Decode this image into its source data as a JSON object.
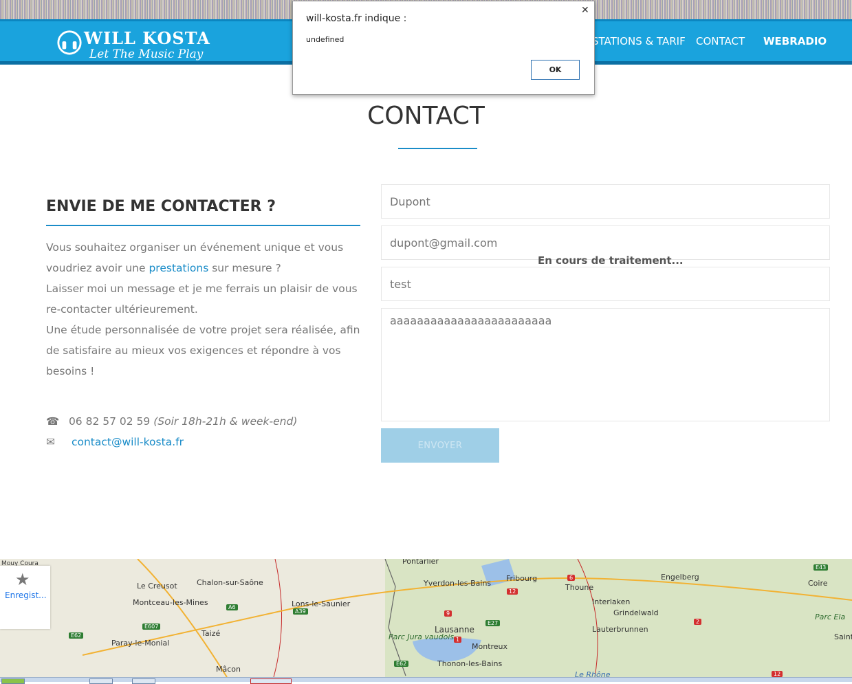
{
  "colors": {
    "brand": "#1aa3dd",
    "accent": "#1a8cc8",
    "button_disabled": "#9fcfe7"
  },
  "header": {
    "logo_title": "WILL KOSTA",
    "logo_subtitle": "Let The Music Play",
    "nav": [
      "STATIONS & TARIF",
      "CONTACT",
      "WEBRADIO"
    ]
  },
  "dialog": {
    "title": "will-kosta.fr indique :",
    "message": "undefined",
    "ok_label": "OK",
    "close_icon": "close-icon"
  },
  "main": {
    "title": "CONTACT",
    "left": {
      "heading": "ENVIE DE ME CONTACTER ?",
      "p1_a": "Vous souhaitez organiser un événement unique et vous voudriez avoir une ",
      "p1_link": "prestations",
      "p1_b": " sur mesure ?",
      "p2": "Laisser moi un message et je me ferrais un plaisir de vous re-contacter ultérieurement.",
      "p3": "Une étude personnalisée de votre projet sera réalisée, afin de satisfaire au mieux vos exigences et répondre à vos besoins !",
      "phone": "06 82 57 02 59",
      "phone_hours": "(Soir 18h-21h & week-end)",
      "email": "contact@will-kosta.fr"
    },
    "form": {
      "name_placeholder": "Dupont",
      "email_placeholder": "dupont@gmail.com",
      "subject_placeholder": "test",
      "message_placeholder": "aaaaaaaaaaaaaaaaaaaaaaaa",
      "processing": "En cours de traitement...",
      "submit_label": "ENVOYER"
    }
  },
  "map": {
    "labels": [
      "Pontarlier",
      "Le Creusot",
      "Chalon-sur-Saône",
      "Montceau-les-Mines",
      "Lons-le-Saunier",
      "Yverdon-les-Bains",
      "Fribourg",
      "Thoune",
      "Interlaken",
      "Grindelwald",
      "Lauterbrunnen",
      "Engelberg",
      "Coire",
      "Parc Ela",
      "Saint",
      "Paray-le-Monial",
      "Taizé",
      "Mâcon",
      "Lausanne",
      "Parc Jura vaudois",
      "Montreux",
      "Thonon-les-Bains",
      "Le Rhône",
      "Mouy Coura"
    ],
    "routes": [
      "A6",
      "E607",
      "E62",
      "A39",
      "9",
      "E27",
      "12",
      "6",
      "1",
      "E62",
      "2",
      "E43",
      "12"
    ]
  },
  "save_widget": {
    "label": "Enregist..."
  }
}
